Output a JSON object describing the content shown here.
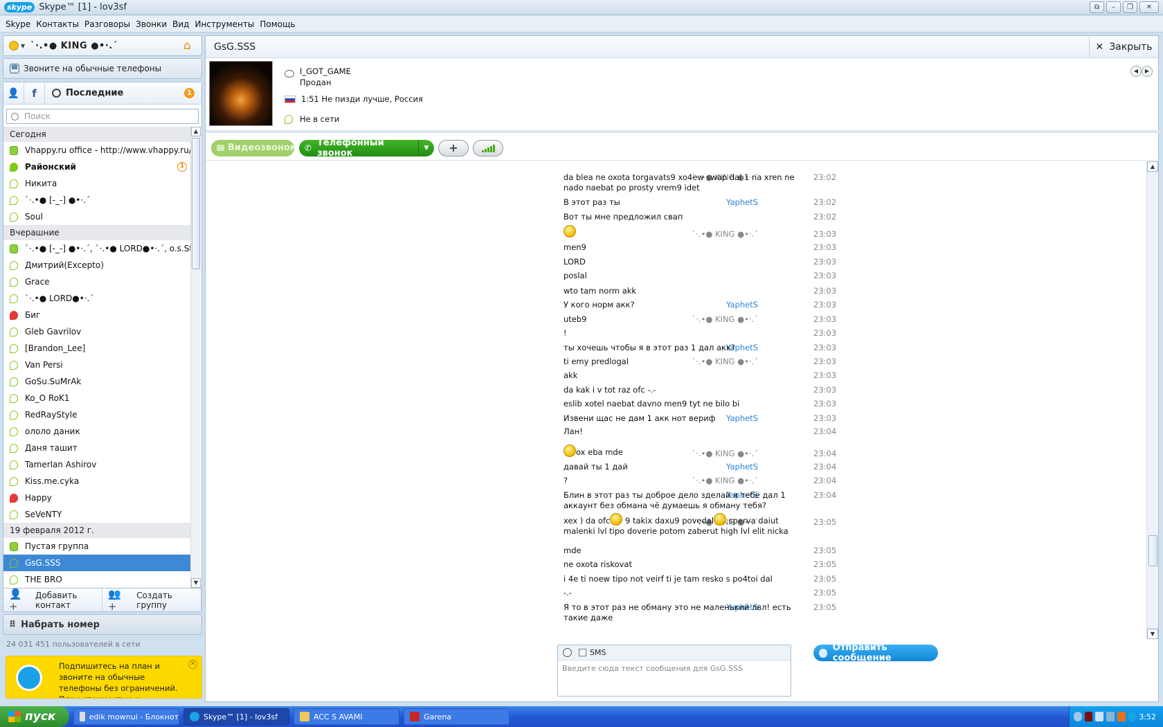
{
  "window": {
    "title": "Skype™ [1] - lov3sf",
    "logo": "skype"
  },
  "menu": [
    "Skype",
    "Контакты",
    "Разговоры",
    "Звонки",
    "Вид",
    "Инструменты",
    "Помощь"
  ],
  "profile_me": {
    "name": "`·.•● KING ●•·.´",
    "status": "online"
  },
  "call_phones_label": "Звоните на обычные телефоны",
  "tabs": {
    "recent_label": "Последние",
    "recent_badge": "1"
  },
  "search_placeholder": "Поиск",
  "contacts": {
    "today_label": "Сегодня",
    "today": [
      {
        "name": "Vhappy.ru office - http://www.vhappy.ru/for...",
        "status": "group"
      },
      {
        "name": "Районский",
        "status": "online",
        "bold": true,
        "badge": "1"
      },
      {
        "name": "Никита",
        "status": "offline"
      },
      {
        "name": "`·.•● [-_-] ●•·.´",
        "status": "offline"
      },
      {
        "name": "Soul",
        "status": "offline"
      }
    ],
    "yesterday_label": "Вчерашние",
    "yesterday": [
      {
        "name": "`·.•● [-_-] ●•·.´, `·.•● LORD●•·.´, o.s.Storm",
        "status": "group"
      },
      {
        "name": "Дмитрий(Excepto)",
        "status": "offline"
      },
      {
        "name": "Grace",
        "status": "offline"
      },
      {
        "name": "`·.•● LORD●•·.´",
        "status": "offline"
      },
      {
        "name": "Биг",
        "status": "red"
      },
      {
        "name": "Gleb Gavrilov",
        "status": "offline"
      },
      {
        "name": "[Brandon_Lee]",
        "status": "offline"
      },
      {
        "name": "Van Persi",
        "status": "offline"
      },
      {
        "name": "GoSu.SuMrAk",
        "status": "offline"
      },
      {
        "name": "Ko_O RoK1",
        "status": "offline"
      },
      {
        "name": "RedRayStyle",
        "status": "offline"
      },
      {
        "name": "ололо даник",
        "status": "offline"
      },
      {
        "name": "Даня ташит",
        "status": "offline"
      },
      {
        "name": "Tamerlan Ashirov",
        "status": "offline"
      },
      {
        "name": "Kiss.me.cyka",
        "status": "offline"
      },
      {
        "name": "Happy",
        "status": "red"
      },
      {
        "name": "SeVeNTY",
        "status": "offline"
      }
    ],
    "date_label": "19 февраля 2012 г.",
    "dated": [
      {
        "name": "Пустая группа",
        "status": "group"
      },
      {
        "name": "GsG.SSS",
        "status": "offline",
        "selected": true
      },
      {
        "name": "THE BRO",
        "status": "offline"
      }
    ]
  },
  "actions": {
    "add_contact": "Добавить контакт",
    "create_group": "Создать группу"
  },
  "dial_label": "Набрать номер",
  "online_count": "24 031 451 пользователей в сети",
  "promo_text": "Подпишитесь на план и звоните на обычные телефоны без ограничений. План стоимостью о...",
  "chat": {
    "name": "GsG.SSS",
    "close_label": "Закрыть",
    "skype_name": "I_GOT_GAME",
    "mood": "Продан",
    "local_time": "1:51 Не пизди лучше, Россия",
    "status_text": "Не в сети"
  },
  "toolbar": {
    "video_call": "Видеозвонок",
    "phone_call": "Телефонный звонок",
    "add_icon": "plus-icon",
    "quality_icon": "signal-bars-icon"
  },
  "messages": [
    {
      "sender": "`·.•● KING ●•·.´",
      "text": "da blea ne oxota torgavats9 xo4ew swap dai 1 na xren ne nado naebat po prosty vrem9 idet",
      "time": "23:02"
    },
    {
      "sender": "YaphetS",
      "text": "В этот раз ты",
      "time": "23:02"
    },
    {
      "sender": "",
      "text": "Вот ты мне предложил свап",
      "time": "23:02"
    },
    {
      "sender": "`·.•● KING ●•·.´",
      "text": "",
      "time": "23:03",
      "emoticon": "smile"
    },
    {
      "sender": "",
      "text": "men9",
      "time": "23:03"
    },
    {
      "sender": "",
      "text": "LORD",
      "time": "23:03"
    },
    {
      "sender": "",
      "text": "poslal",
      "time": "23:03"
    },
    {
      "sender": "",
      "text": "wto tam norm akk",
      "time": "23:03"
    },
    {
      "sender": "YaphetS",
      "text": "У кого норм акк?",
      "time": "23:03"
    },
    {
      "sender": "`·.•● KING ●•·.´",
      "text": " uteb9",
      "time": "23:03"
    },
    {
      "sender": "",
      "text": "!",
      "time": "23:03"
    },
    {
      "sender": "YaphetS",
      "text": "ты хочешь чтобы я в этот раз 1 дал акк?",
      "time": "23:03"
    },
    {
      "sender": "`·.•● KING ●•·.´",
      "text": "ti emy predlogal",
      "time": "23:03"
    },
    {
      "sender": "",
      "text": "akk",
      "time": "23:03"
    },
    {
      "sender": "",
      "text": "da kak i v tot raz ofc -.-",
      "time": "23:03"
    },
    {
      "sender": "",
      "text": "eslib xotel naebat davno men9 tyt ne bilo bi",
      "time": "23:03"
    },
    {
      "sender": "YaphetS",
      "text": "Извени щас не дам 1 акк нот вериф",
      "time": "23:03"
    },
    {
      "sender": "",
      "text": "Лан!",
      "time": "23:04"
    },
    {
      "sender": "`·.•● KING ●•·.´",
      "text": "ox eba mde",
      "time": "23:04",
      "emoticon": "smile"
    },
    {
      "sender": "YaphetS",
      "text": "давай ты 1 дай",
      "time": "23:04"
    },
    {
      "sender": "`·.•● KING ●•·.´",
      "text": "?",
      "time": "23:04"
    },
    {
      "sender": "YaphetS",
      "text": "Блин в этот раз ты доброе дело зделай я тебе дал 1 аккаунт без обмана чё думаешь я обману тебя?",
      "time": "23:04"
    },
    {
      "sender": "`·.•● KING ●•·.´",
      "text": "xex ) da ofc",
      "text2": " 9 takix daxu9 povedal",
      "text3": " sperva daiut malenki lvl tipo doverie potom zaberut high lvl elit nicka",
      "time": "23:05",
      "emoticon": "smile"
    },
    {
      "sender": "",
      "text": "mde",
      "time": "23:05"
    },
    {
      "sender": "",
      "text": "ne oxota riskovat",
      "time": "23:05"
    },
    {
      "sender": "",
      "text": "i 4e ti noew tipo not veirf ti je tam resko s po4toi dal",
      "time": "23:05"
    },
    {
      "sender": "",
      "text": "-.-",
      "time": "23:05"
    },
    {
      "sender": "YaphetS",
      "text": "Я то в этот раз не обману это не маленький лвл! есть такие даже",
      "time": "23:05"
    }
  ],
  "input": {
    "sms_label": "SMS",
    "placeholder": "Введите сюда текст сообщения для GsG.SSS",
    "send_label": "Отправить сообщение"
  },
  "taskbar": {
    "start_label": "пуск",
    "tasks": [
      "edik mownui - Блокнот",
      "Skype™ [1] - lov3sf",
      "ACC S AVAMI",
      "Garena"
    ],
    "clock": "3:52"
  }
}
